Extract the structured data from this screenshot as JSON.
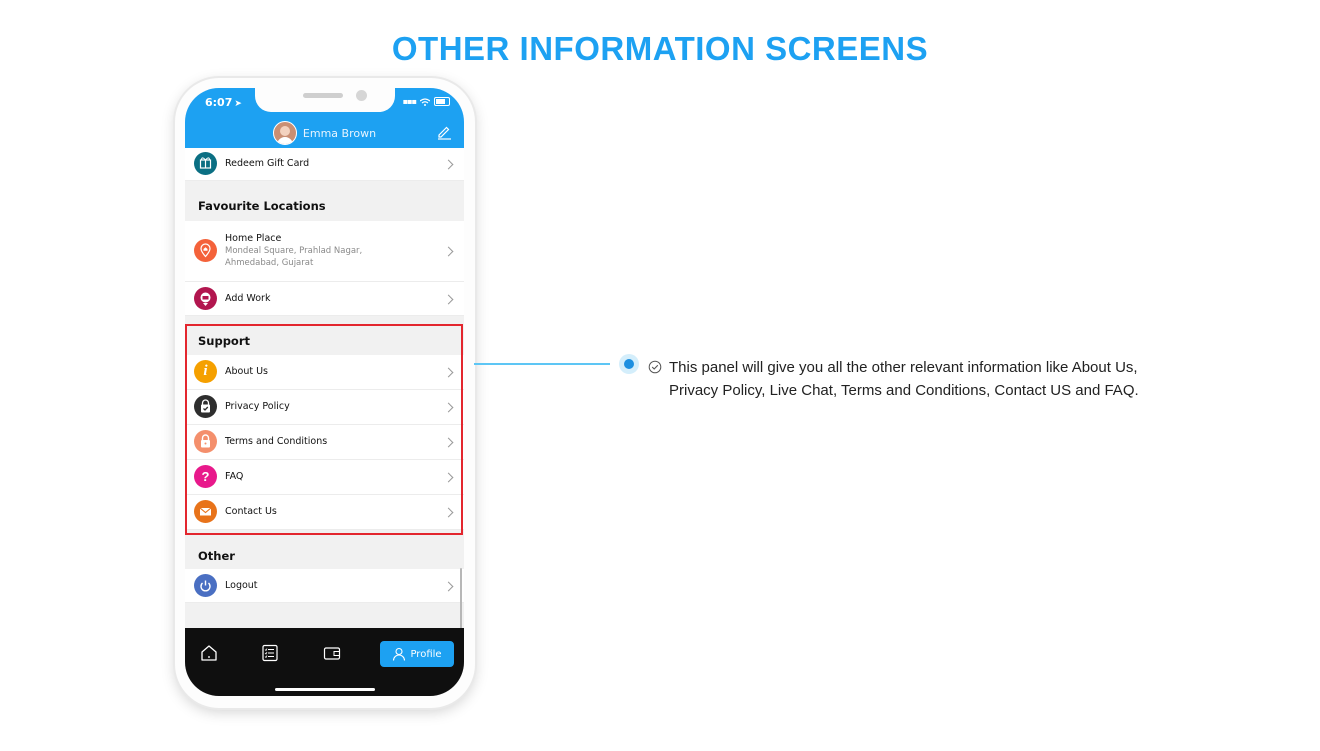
{
  "page": {
    "title": "OTHER INFORMATION SCREENS",
    "description": "This panel will give you all the other relevant information like About Us, Privacy Policy, Live Chat, Terms and Conditions, Contact US and FAQ."
  },
  "colors": {
    "accent": "#1da1f2",
    "highlight_border": "#e3262e",
    "tabbar": "#0f0f0f"
  },
  "status_bar": {
    "time": "6:07"
  },
  "header": {
    "user_name": "Emma Brown",
    "avatar_icon": "avatar",
    "edit_icon": "edit-pencil-icon"
  },
  "rows": {
    "redeem_gift_card": {
      "label": "Redeem Gift Card",
      "icon": "gift-card-icon",
      "color": "#0b6f83"
    },
    "home_place": {
      "label": "Home Place",
      "address_line1": "Mondeal Square, Prahlad Nagar,",
      "address_line2": "Ahmedabad, Gujarat",
      "icon": "home-pin-icon",
      "color": "#f4623a"
    },
    "add_work": {
      "label": "Add Work",
      "icon": "work-pin-icon",
      "color": "#b2164f"
    },
    "about_us": {
      "label": "About Us",
      "icon": "info-icon",
      "color": "#f5a000"
    },
    "privacy_policy": {
      "label": "Privacy Policy",
      "icon": "shield-check-icon",
      "color": "#2e2e2e"
    },
    "terms_and_conditions": {
      "label": "Terms and Conditions",
      "icon": "lock-icon",
      "color": "#f48f6c"
    },
    "faq": {
      "label": "FAQ",
      "icon": "question-icon",
      "color": "#e8198b"
    },
    "contact_us": {
      "label": "Contact Us",
      "icon": "mail-icon",
      "color": "#e8731a"
    },
    "logout": {
      "label": "Logout",
      "icon": "power-icon",
      "color": "#4a6fc2"
    }
  },
  "sections": {
    "favourite_locations": "Favourite Locations",
    "support": "Support",
    "other": "Other"
  },
  "tabbar": {
    "tabs": [
      {
        "name": "home",
        "icon": "home-icon"
      },
      {
        "name": "bookings",
        "icon": "list-icon"
      },
      {
        "name": "wallet",
        "icon": "wallet-icon"
      }
    ],
    "active_tab_label": "Profile"
  }
}
